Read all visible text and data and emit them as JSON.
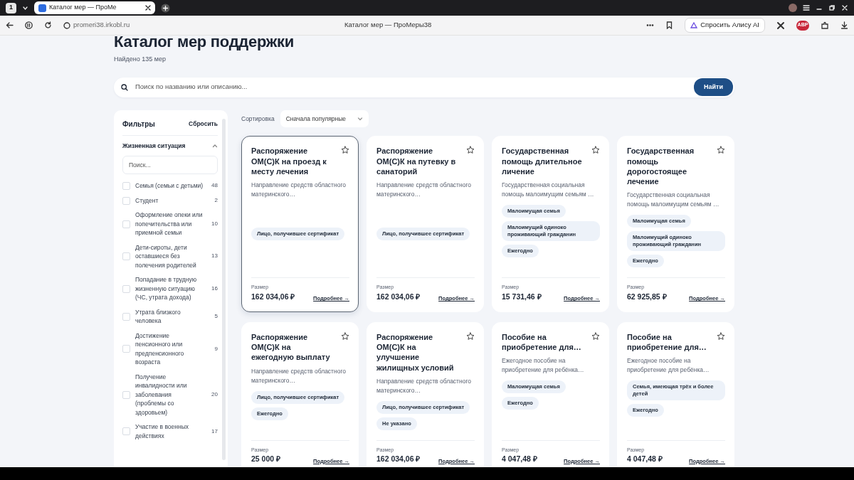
{
  "browser": {
    "tab_count": "1",
    "tab_title": "Каталог мер — ПроМе",
    "url": "promeri38.irkobl.ru",
    "page_title": "Каталог мер — ПроМеры38",
    "assistant_button": "Спросить Алису AI",
    "adblock_badge": "ABP"
  },
  "page": {
    "title": "Каталог мер поддержки",
    "found": "Найдено 135 мер",
    "search": {
      "placeholder": "Поиск по названию или описанию..."
    },
    "search_button": "Найти"
  },
  "filters": {
    "title": "Фильтры",
    "reset": "Сбросить",
    "section": {
      "title": "Жизненная ситуация",
      "expanded": true,
      "search_placeholder": "Поиск...",
      "items": [
        {
          "label": "Семья (семьи с детьми)",
          "count": "48",
          "checked": false
        },
        {
          "label": "Студент",
          "count": "2",
          "checked": false
        },
        {
          "label": "Оформление опеки или попечительства или приемной семьи",
          "count": "10",
          "checked": false
        },
        {
          "label": "Дети-сироты, дети оставшиеся без полечения родителей",
          "count": "13",
          "checked": false
        },
        {
          "label": "Попадание в трудную жизненную ситуацию (ЧС, утрата дохода)",
          "count": "16",
          "checked": false
        },
        {
          "label": "Утрата близкого человека",
          "count": "5",
          "checked": false
        },
        {
          "label": "Достижение пенсионного или предпенсионного возраста",
          "count": "9",
          "checked": false
        },
        {
          "label": "Получение инвалидности или заболевания (проблемы со здоровьем)",
          "count": "20",
          "checked": false
        },
        {
          "label": "Участие в военных действиях",
          "count": "17",
          "checked": false
        }
      ]
    }
  },
  "sort": {
    "label": "Сортировка",
    "value": "Сначала популярные"
  },
  "cards": [
    {
      "title": "Распоряжение ОМ(С)К на проезд к месту лечения",
      "description": "Направление средств областного материнского…",
      "tags": [
        "Лицо, получившее сертификат"
      ],
      "size_label": "Размер",
      "amount": "162 034,06 ₽",
      "more": "Подробнее →",
      "highlighted": true,
      "favorite": false
    },
    {
      "title": "Распоряжение ОМ(С)К на путевку в санаторий",
      "description": "Направление средств областного материнского…",
      "tags": [
        "Лицо, получившее сертификат"
      ],
      "size_label": "Размер",
      "amount": "162 034,06 ₽",
      "more": "Подробнее →",
      "highlighted": false,
      "favorite": false
    },
    {
      "title": "Государственная помощь длительное личение",
      "description": "Государственная социальная помощь малоимущим семьям …",
      "tags": [
        "Малоимущая семья",
        "Малоимущий одиноко проживающий гражданин",
        "Ежегодно"
      ],
      "size_label": "Размер",
      "amount": "15 731,46 ₽",
      "more": "Подробнее →",
      "highlighted": false,
      "favorite": false
    },
    {
      "title": "Государственная помощь дорогостоящее лечение",
      "description": "Государственная социальная помощь малоимущим семьям …",
      "tags": [
        "Малоимущая семья",
        "Малоимущий одиноко проживающий гражданин",
        "Ежегодно"
      ],
      "size_label": "Размер",
      "amount": "62 925,85 ₽",
      "more": "Подробнее →",
      "highlighted": false,
      "favorite": false
    },
    {
      "title": "Распоряжение ОМ(С)К на ежегодную выплату",
      "description": "Направление средств областного материнского…",
      "tags": [
        "Лицо, получившее сертификат",
        "Ежегодно"
      ],
      "size_label": "Размер",
      "amount": "25 000 ₽",
      "more": "Подробнее →",
      "highlighted": false,
      "favorite": false
    },
    {
      "title": "Распоряжение ОМ(С)К на улучшение жилищных условий",
      "description": "Направление средств областного материнского…",
      "tags": [
        "Лицо, получившее сертификат",
        "Не указано"
      ],
      "size_label": "Размер",
      "amount": "162 034,06 ₽",
      "more": "Подробнее →",
      "highlighted": false,
      "favorite": false
    },
    {
      "title": "Пособие на приобретение для…",
      "description": "Ежегодное пособие на приобретение для ребёнка…",
      "tags": [
        "Малоимущая семья",
        "Ежегодно"
      ],
      "size_label": "Размер",
      "amount": "4 047,48 ₽",
      "more": "Подробнее →",
      "highlighted": false,
      "favorite": false
    },
    {
      "title": "Пособие на приобретение для…",
      "description": "Ежегодное пособие на приобретение для ребёнка…",
      "tags": [
        "Семья, имеющая трёх и более детей",
        "Ежегодно"
      ],
      "size_label": "Размер",
      "amount": "4 047,48 ₽",
      "more": "Подробнее →",
      "highlighted": false,
      "favorite": false
    }
  ]
}
